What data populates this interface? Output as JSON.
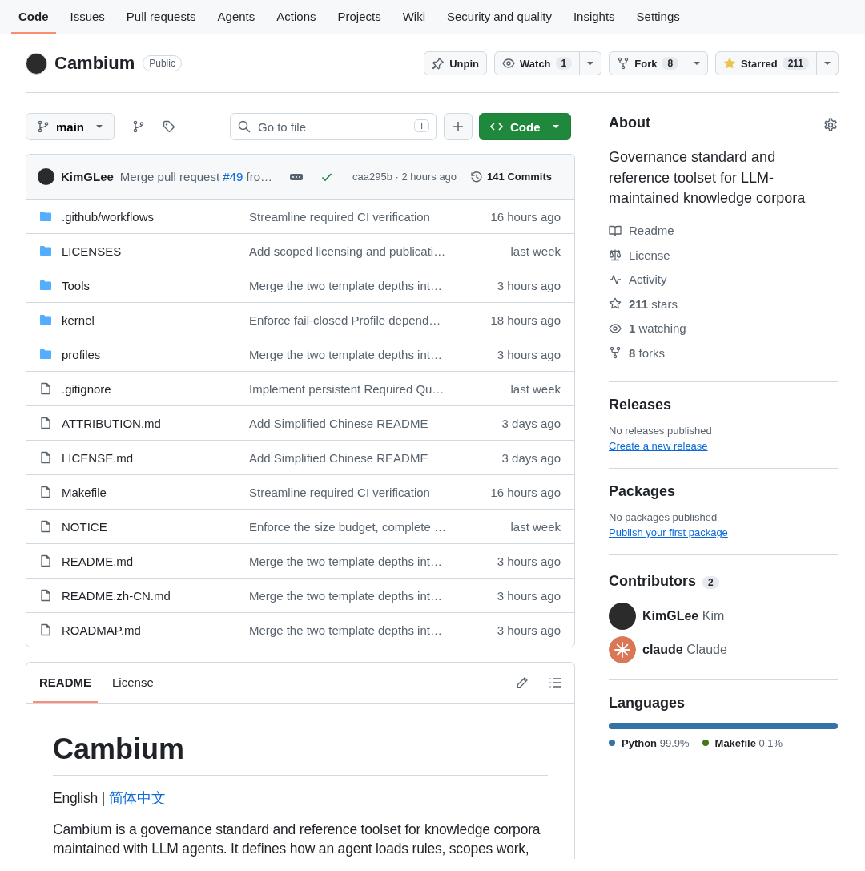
{
  "nav": [
    {
      "label": "Code",
      "selected": true
    },
    {
      "label": "Issues",
      "selected": false
    },
    {
      "label": "Pull requests",
      "selected": false
    },
    {
      "label": "Agents",
      "selected": false
    },
    {
      "label": "Actions",
      "selected": false
    },
    {
      "label": "Projects",
      "selected": false
    },
    {
      "label": "Wiki",
      "selected": false
    },
    {
      "label": "Security and quality",
      "selected": false
    },
    {
      "label": "Insights",
      "selected": false
    },
    {
      "label": "Settings",
      "selected": false
    }
  ],
  "repo": {
    "name": "Cambium",
    "visibility": "Public",
    "actions": [
      {
        "kind": "pin",
        "label": "Unpin"
      },
      {
        "kind": "watch",
        "label": "Watch",
        "count": "1"
      },
      {
        "kind": "fork",
        "label": "Fork",
        "count": "8"
      },
      {
        "kind": "star",
        "label": "Starred",
        "count": "211"
      }
    ]
  },
  "toolbar": {
    "branch": "main",
    "search": {
      "placeholder": "Go to file",
      "shortcut": "T"
    },
    "code_button": "Code"
  },
  "commit": {
    "author": "KimGLee",
    "message": "Merge pull request",
    "pr": "#49",
    "message_tail": "fro…",
    "hash_time": "caa295b · 2 hours ago",
    "commits": "141 Commits"
  },
  "files": [
    {
      "kind": "folder",
      "name": ".github/workflows",
      "message": "Streamline required CI verification",
      "time": "16 hours ago"
    },
    {
      "kind": "folder",
      "name": "LICENSES",
      "message": "Add scoped licensing and publicati…",
      "time": "last week"
    },
    {
      "kind": "folder",
      "name": "Tools",
      "message": "Merge the two template depths int…",
      "time": "3 hours ago"
    },
    {
      "kind": "folder",
      "name": "kernel",
      "message": "Enforce fail-closed Profile depend…",
      "time": "18 hours ago"
    },
    {
      "kind": "folder",
      "name": "profiles",
      "message": "Merge the two template depths int…",
      "time": "3 hours ago"
    },
    {
      "kind": "file",
      "name": ".gitignore",
      "message": "Implement persistent Required Qu…",
      "time": "last week"
    },
    {
      "kind": "file",
      "name": "ATTRIBUTION.md",
      "message": "Add Simplified Chinese README",
      "time": "3 days ago"
    },
    {
      "kind": "file",
      "name": "LICENSE.md",
      "message": "Add Simplified Chinese README",
      "time": "3 days ago"
    },
    {
      "kind": "file",
      "name": "Makefile",
      "message": "Streamline required CI verification",
      "time": "16 hours ago"
    },
    {
      "kind": "file",
      "name": "NOTICE",
      "message": "Enforce the size budget, complete …",
      "time": "last week"
    },
    {
      "kind": "file",
      "name": "README.md",
      "message": "Merge the two template depths int…",
      "time": "3 hours ago"
    },
    {
      "kind": "file",
      "name": "README.zh-CN.md",
      "message": "Merge the two template depths int…",
      "time": "3 hours ago"
    },
    {
      "kind": "file",
      "name": "ROADMAP.md",
      "message": "Merge the two template depths int…",
      "time": "3 hours ago"
    }
  ],
  "readme": {
    "tabs": [
      {
        "label": "README",
        "selected": true
      },
      {
        "label": "License",
        "selected": false
      }
    ],
    "title": "Cambium",
    "language_line": "English |",
    "language_link": "简体中文",
    "paragraph": "Cambium is a governance standard and reference toolset for knowledge corpora maintained with LLM agents. It defines how an agent loads rules, scopes work,"
  },
  "sidebar": {
    "about": {
      "title": "About",
      "description": "Governance standard and reference toolset for LLM-maintained knowledge corpora",
      "links": [
        {
          "kind": "book",
          "label": "Readme"
        },
        {
          "kind": "scale",
          "label": "License"
        },
        {
          "kind": "pulse",
          "label": "Activity"
        },
        {
          "kind": "star",
          "count": "211",
          "label": "stars"
        },
        {
          "kind": "eye",
          "count": "1",
          "label": "watching"
        },
        {
          "kind": "fork",
          "count": "8",
          "label": "forks"
        }
      ]
    },
    "releases": {
      "title": "Releases",
      "text": "No releases published",
      "link": "Create a new release"
    },
    "packages": {
      "title": "Packages",
      "text": "No packages published",
      "link": "Publish your first package"
    },
    "contributors": {
      "title": "Contributors",
      "count": "2",
      "people": [
        {
          "login": "KimGLee",
          "name": "Kim",
          "kind": "photo"
        },
        {
          "login": "claude",
          "name": "Claude",
          "kind": "burst"
        }
      ]
    },
    "languages": {
      "title": "Languages",
      "items": [
        {
          "name": "Python",
          "percent": "99.9%",
          "level": 0.999,
          "color": "#3572a5"
        },
        {
          "name": "Makefile",
          "percent": "0.1%",
          "level": 0.001,
          "color": "#427819"
        }
      ]
    }
  }
}
